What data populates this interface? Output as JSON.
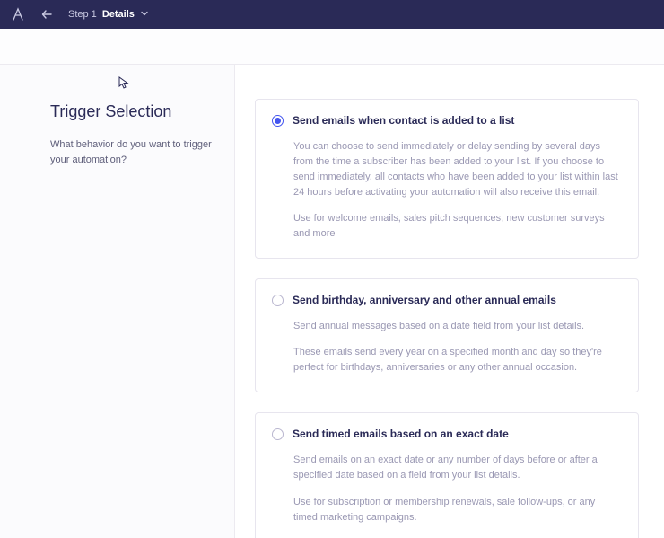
{
  "topbar": {
    "step_prefix": "Step 1",
    "step_name": "Details"
  },
  "sidebar": {
    "title": "Trigger Selection",
    "subtitle": "What behavior do you want to trigger your automation?"
  },
  "options": [
    {
      "selected": true,
      "title": "Send emails when contact is added to a list",
      "paragraphs": [
        "You can choose to send immediately or delay sending by several days from the time a subscriber has been added to your list. If you choose to send immediately, all contacts who have been added to your list within last 24 hours before activating your automation will also receive this email.",
        "Use for welcome emails, sales pitch sequences, new customer surveys and more"
      ]
    },
    {
      "selected": false,
      "title": "Send birthday, anniversary and other annual emails",
      "paragraphs": [
        "Send annual messages based on a date field from your list details.",
        "These emails send every year on a specified month and day so they're perfect for birthdays, anniversaries or any other annual occasion."
      ]
    },
    {
      "selected": false,
      "title": "Send timed emails based on an exact date",
      "paragraphs": [
        "Send emails on an exact date or any number of days before or after a specified date based on a field from your list details.",
        "Use for subscription or membership renewals, sale follow-ups, or any timed marketing campaigns."
      ]
    }
  ]
}
